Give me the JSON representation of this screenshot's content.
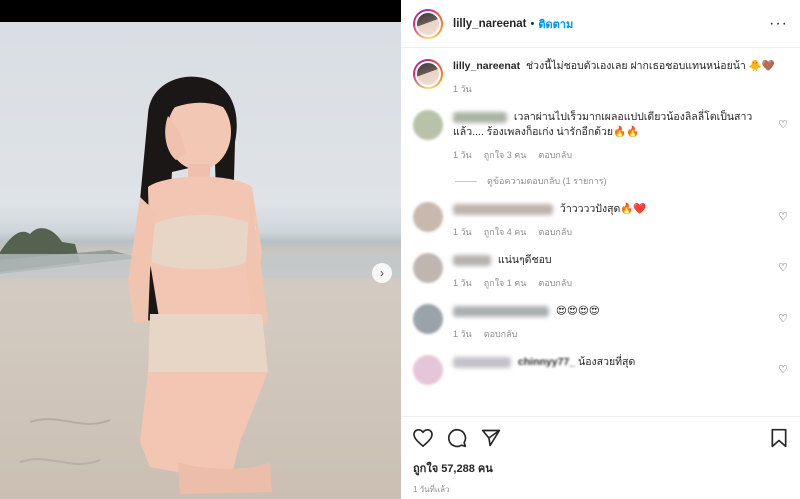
{
  "header": {
    "username": "lilly_nareenat",
    "separator": "•",
    "follow_label": "ติดตาม",
    "more_label": "···"
  },
  "caption": {
    "username": "lilly_nareenat",
    "text": "ช่วงนี้ไม่ชอบตัวเองเลย ฝากเธอชอบแทนหน่อยน้า 🐥🤎",
    "time": "1 วัน"
  },
  "comments": [
    {
      "text": "เวลาผ่านไปเร็วมากเผลอแปปเดียวน้องลิลลี่โตเป็นสาวแล้ว.... ร้องเพลงก็อเก่ง น่ารักอีกด้วย🔥🔥",
      "time": "1 วัน",
      "likes": "ถูกใจ 3 คน",
      "reply": "ตอบกลับ",
      "view_replies": "ดูข้อความตอบกลับ (1 รายการ)"
    },
    {
      "text": "ว้าววววปังสุด🔥❤️",
      "time": "1 วัน",
      "likes": "ถูกใจ 4 คน",
      "reply": "ตอบกลับ"
    },
    {
      "text": "แน่นๆดีชอบ",
      "time": "1 วัน",
      "likes": "ถูกใจ 1 คน",
      "reply": "ตอบกลับ"
    },
    {
      "text": "😍😍😍😍",
      "time": "1 วัน",
      "reply": "ตอบกลับ"
    },
    {
      "text": "น้องสวยที่สุด",
      "name_partial": "chinnyy77_"
    }
  ],
  "actions": {
    "likes": "ถูกใจ 57,288 คน",
    "posted": "1 วันที่แล้ว"
  },
  "icons": {
    "like": "heart-icon",
    "comment": "comment-icon",
    "share": "send-icon",
    "save": "bookmark-icon",
    "next": "chevron-right-icon"
  },
  "colors": {
    "accent": "#0095f6",
    "text": "#262626",
    "muted": "#8e8e8e"
  }
}
